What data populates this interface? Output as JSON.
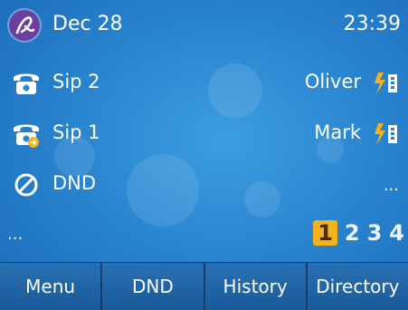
{
  "statusbar": {
    "date": "Dec 28",
    "time": "23:39"
  },
  "lines": [
    {
      "label": "Sip 2",
      "icon": "phone-icon"
    },
    {
      "label": "Sip 1",
      "icon": "phone-forward-icon"
    },
    {
      "label": "DND",
      "icon": "dnd-icon"
    }
  ],
  "contacts": [
    {
      "label": "Oliver",
      "icon": "presence-busy-icon"
    },
    {
      "label": "Mark",
      "icon": "presence-busy-icon"
    }
  ],
  "more_left": "...",
  "more_right": "...",
  "pages": [
    "1",
    "2",
    "3",
    "4"
  ],
  "active_page": "1",
  "softkeys": [
    "Menu",
    "DND",
    "History",
    "Directory"
  ],
  "colors": {
    "background": "#2a86d0",
    "accent": "#f2b21e",
    "logo": "#6b3fa0"
  }
}
